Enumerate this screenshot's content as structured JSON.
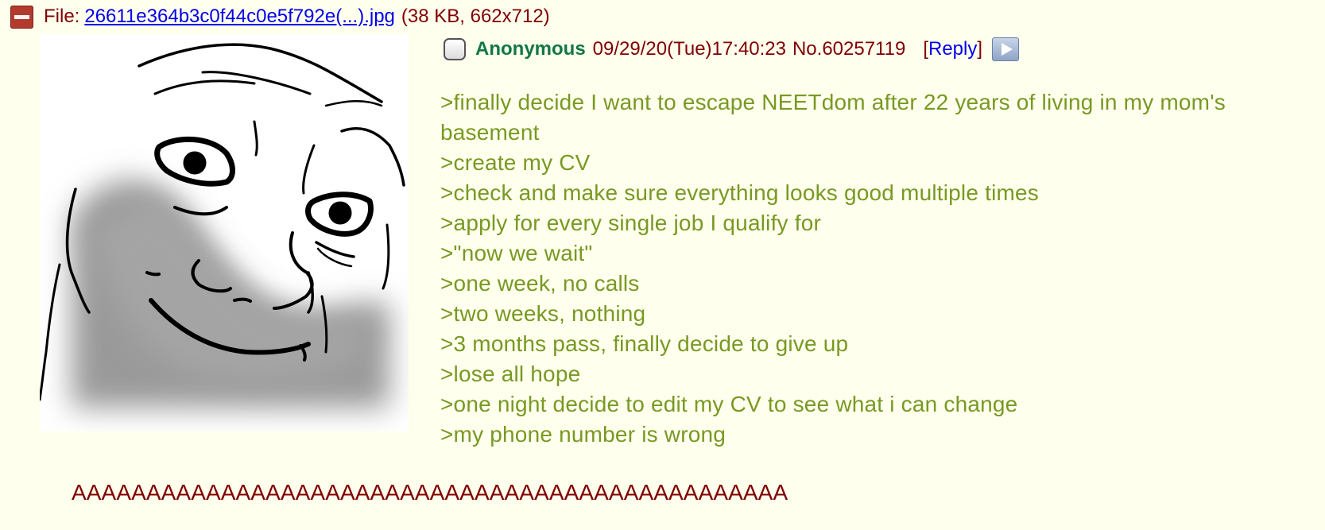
{
  "file": {
    "label": "File:",
    "filename": "26611e364b3c0f44c0e5f792e(...).jpg",
    "meta": "(38 KB, 662x712)",
    "collapse_icon": "minus-icon"
  },
  "post": {
    "name": "Anonymous",
    "datetime": "09/29/20(Tue)17:40:23",
    "number": "No.60257119",
    "reply_open": "[",
    "reply_label": "Reply",
    "reply_close": "]",
    "menu_icon": "play-icon",
    "lines": [
      ">finally decide I want to escape NEETdom after 22 years of living in my mom's basement",
      ">create my CV",
      ">check and make sure everything looks good multiple times",
      ">apply for every single job I qualify for",
      ">\"now we wait\"",
      ">one week, no calls",
      ">two weeks, nothing",
      ">3 months pass, finally decide to give up",
      ">lose all hope",
      ">one night decide to edit my CV to see what i can change",
      ">my phone number is wrong"
    ],
    "closing": "AAAAAAAAAAAAAAAAAAAAAAAAAAAAAAAAAAAAAAAAAAAAAAAA"
  },
  "colors": {
    "background": "#ffffee",
    "greentext": "#789922",
    "name": "#117743",
    "maroon": "#800000",
    "link": "#0000ee"
  }
}
